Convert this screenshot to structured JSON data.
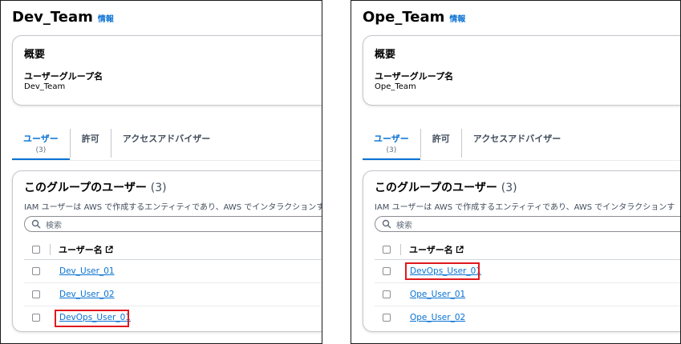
{
  "panels": [
    {
      "title": "Dev_Team",
      "info": "情報",
      "summary": {
        "heading": "概要",
        "field_label": "ユーザーグループ名",
        "field_value": "Dev_Team"
      },
      "tabs": [
        {
          "label": "ユーザー",
          "count": "(3)"
        },
        {
          "label": "許可"
        },
        {
          "label": "アクセスアドバイザー"
        }
      ],
      "users": {
        "heading": "このグループのユーザー",
        "count": "(3)",
        "description": "IAM ユーザーは AWS で作成するエンティティであり、AWS でインタラクションす",
        "search_placeholder": "検索",
        "column_header": "ユーザー名",
        "rows": [
          "Dev_User_01",
          "Dev_User_02",
          "DevOps_User_01"
        ],
        "highlighted_row": "DevOps_User_01"
      }
    },
    {
      "title": "Ope_Team",
      "info": "情報",
      "summary": {
        "heading": "概要",
        "field_label": "ユーザーグループ名",
        "field_value": "Ope_Team"
      },
      "tabs": [
        {
          "label": "ユーザー",
          "count": "(3)"
        },
        {
          "label": "許可"
        },
        {
          "label": "アクセスアドバイザー"
        }
      ],
      "users": {
        "heading": "このグループのユーザー",
        "count": "(3)",
        "description": "IAM ユーザーは AWS で作成するエンティティであり、AWS でインタラクションす",
        "search_placeholder": "検索",
        "column_header": "ユーザー名",
        "rows": [
          "DevOps_User_01",
          "Ope_User_01",
          "Ope_User_02"
        ],
        "highlighted_row": "DevOps_User_01"
      }
    }
  ],
  "colors": {
    "link": "#0972d3",
    "highlight": "#e0191e",
    "border": "#1a1a1a"
  },
  "icons": [
    "search-icon",
    "external-link-icon"
  ]
}
